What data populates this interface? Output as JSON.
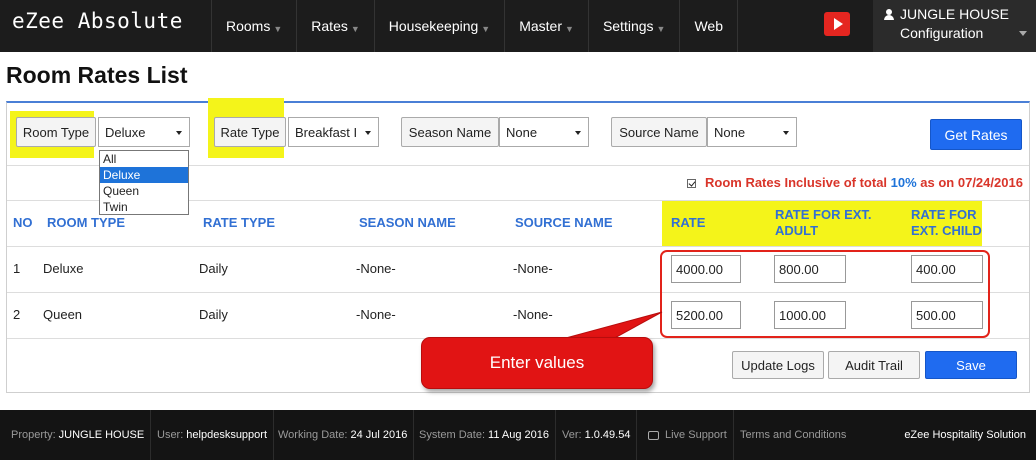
{
  "app": {
    "title": "eZee Absolute"
  },
  "nav": {
    "items": [
      {
        "label": "Rooms",
        "has_caret": true
      },
      {
        "label": "Rates",
        "has_caret": true
      },
      {
        "label": "Housekeeping",
        "has_caret": true
      },
      {
        "label": "Master",
        "has_caret": true
      },
      {
        "label": "Settings",
        "has_caret": true
      },
      {
        "label": "Web",
        "has_caret": false
      }
    ],
    "youtube_icon": "youtube-icon",
    "user": {
      "name": "JUNGLE HOUSE",
      "sub": "Configuration",
      "icon": "user-icon"
    }
  },
  "page": {
    "title": "Room Rates List"
  },
  "filters": {
    "room_type": {
      "label": "Room Type",
      "value": "Deluxe"
    },
    "rate_type": {
      "label": "Rate Type",
      "value": "Breakfast I"
    },
    "season": {
      "label": "Season Name",
      "value": "None"
    },
    "source": {
      "label": "Source Name",
      "value": "None"
    },
    "get_rates": "Get Rates",
    "room_type_options": [
      "All",
      "Deluxe",
      "Queen",
      "Twin"
    ],
    "room_type_selected_index": 1
  },
  "inclusive_note": {
    "checked": true,
    "prefix": "Room Rates Inclusive of total ",
    "percent": "10%",
    "suffix": " as on 07/24/2016"
  },
  "table": {
    "headers": {
      "no": "NO",
      "room_type": "ROOM TYPE",
      "rate_type": "RATE TYPE",
      "season": "SEASON NAME",
      "source": "SOURCE NAME",
      "rate": "RATE",
      "ext_adult": "RATE FOR EXT. ADULT",
      "ext_child": "RATE FOR EXT. CHILD"
    },
    "rows": [
      {
        "no": "1",
        "room_type": "Deluxe",
        "rate_type": "Daily",
        "season": "-None-",
        "source": "-None-",
        "rate": "4000.00",
        "ext_adult": "800.00",
        "ext_child": "400.00"
      },
      {
        "no": "2",
        "room_type": "Queen",
        "rate_type": "Daily",
        "season": "-None-",
        "source": "-None-",
        "rate": "5200.00",
        "ext_adult": "1000.00",
        "ext_child": "500.00"
      }
    ]
  },
  "actions": {
    "update_logs": "Update Logs",
    "audit_trail": "Audit Trail",
    "save": "Save"
  },
  "callout": {
    "text": "Enter values"
  },
  "footer": {
    "property_label": "Property:",
    "property_value": "JUNGLE HOUSE",
    "user_label": "User:",
    "user_value": "helpdesksupport",
    "working_label": "Working Date:",
    "working_value": "24 Jul 2016",
    "system_label": "System Date:",
    "system_value": "11 Aug 2016",
    "ver_label": "Ver:",
    "ver_value": "1.0.49.54",
    "live_support": "Live Support",
    "terms": "Terms and Conditions",
    "brand": "eZee Hospitality Solution"
  },
  "colors": {
    "accent": "#1f6bf0",
    "highlight": "#f4f41a",
    "callout": "#e11414",
    "header_text": "#3270d3"
  }
}
